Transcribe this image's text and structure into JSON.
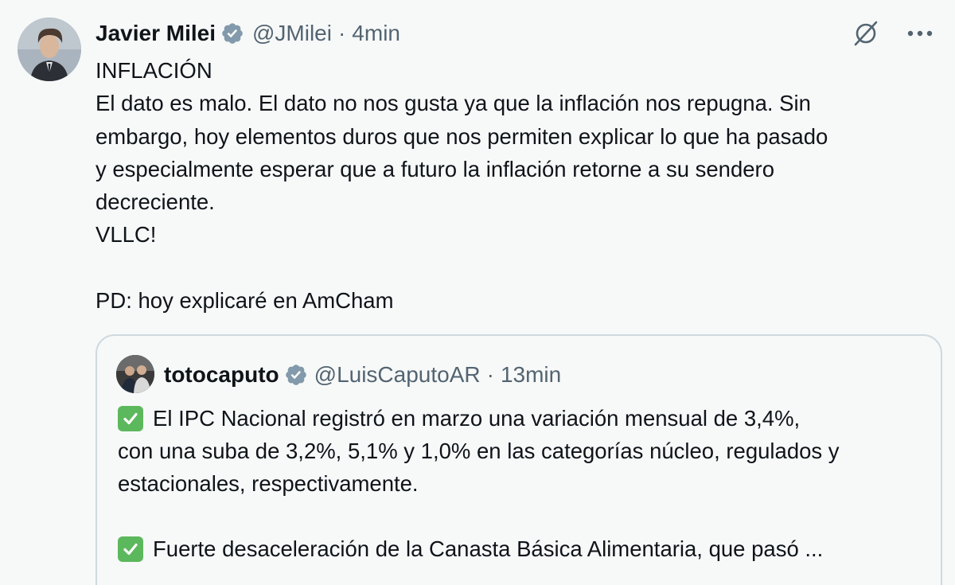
{
  "tweet": {
    "author": {
      "display_name": "Javier Milei",
      "handle": "@JMilei",
      "time": "4min",
      "verified": true,
      "avatar_icon": "avatar"
    },
    "actions": {
      "grok_icon": "grok-icon",
      "more_icon": "more-icon"
    },
    "lines": [
      "INFLACIÓN",
      "El dato es malo. El dato no nos gusta ya que la inflación nos repugna. Sin",
      "embargo, hoy elementos duros que nos permiten explicar lo que ha pasado",
      "y especialmente esperar que a futuro la inflación retorne a su sendero",
      "decreciente.",
      "VLLC!",
      "",
      "PD: hoy explicaré en AmCham"
    ]
  },
  "quoted": {
    "author": {
      "display_name": "totocaputo",
      "handle": "@LuisCaputoAR",
      "time": "13min",
      "verified": true
    },
    "lines": [
      "El IPC Nacional registró en marzo una variación mensual de 3,4%,",
      "con una suba de 3,2%, 5,1% y 1,0% en las categorías núcleo, regulados y",
      "estacionales, respectivamente.",
      "",
      "Fuerte desaceleración de la Canasta Básica Alimentaria, que pasó ..."
    ],
    "bullet_icon": "check-mark-icon"
  },
  "colors": {
    "text": "#0f1419",
    "muted": "#536471",
    "background": "#f7f9f9",
    "border": "#cfd9de",
    "verified_badge": "#829aab",
    "check_green": "#5cb85c"
  },
  "separator": "·"
}
